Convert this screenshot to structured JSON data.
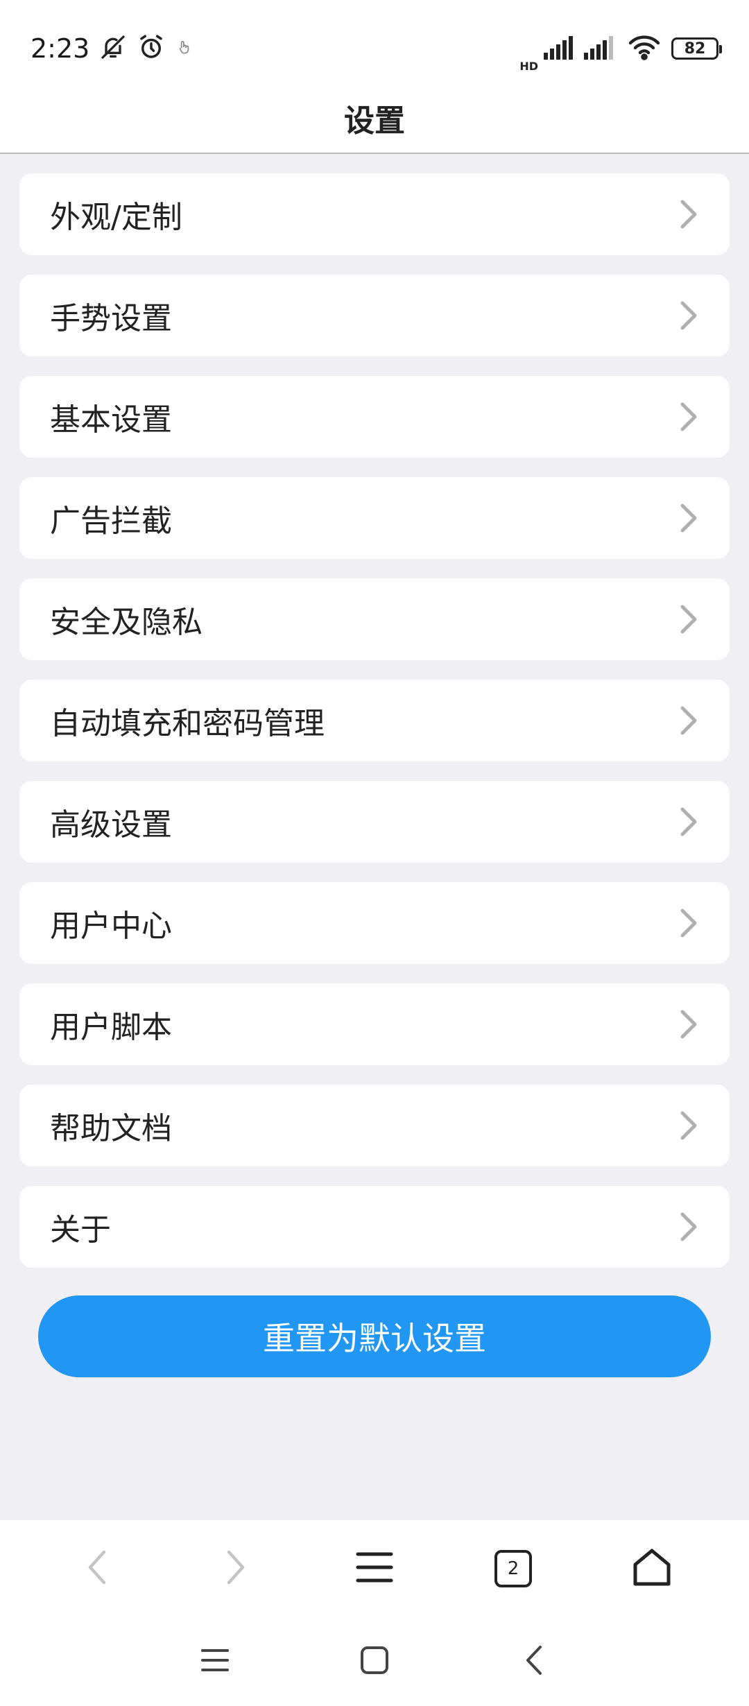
{
  "status_bar": {
    "time": "2:23",
    "battery": "82",
    "network_label": "HD"
  },
  "header": {
    "title": "设置"
  },
  "settings": {
    "items": [
      {
        "label": "外观/定制"
      },
      {
        "label": "手势设置"
      },
      {
        "label": "基本设置"
      },
      {
        "label": "广告拦截"
      },
      {
        "label": "安全及隐私"
      },
      {
        "label": "自动填充和密码管理"
      },
      {
        "label": "高级设置"
      },
      {
        "label": "用户中心"
      },
      {
        "label": "用户脚本"
      },
      {
        "label": "帮助文档"
      },
      {
        "label": "关于"
      }
    ]
  },
  "reset_button": {
    "label": "重置为默认设置"
  },
  "toolbar": {
    "tab_count": "2",
    "icons": [
      "back-icon",
      "forward-icon",
      "menu-icon",
      "tabs-icon",
      "home-icon"
    ]
  },
  "colors": {
    "accent": "#2196f3",
    "background": "#efeff4",
    "chevron": "#b0b0b0"
  }
}
